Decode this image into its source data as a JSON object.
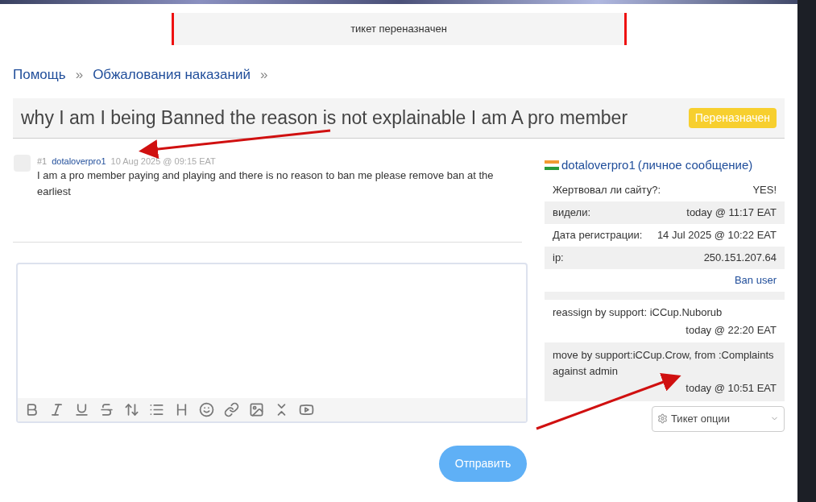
{
  "notice": "тикет переназначен",
  "breadcrumbs": [
    {
      "label": "Помощь",
      "separator": "»"
    },
    {
      "label": "Обжалования наказаний",
      "separator": "»"
    }
  ],
  "ticket": {
    "title": "why I am I being Banned the reason is not explainable I am A pro member",
    "status": "Переназначен"
  },
  "post": {
    "number": "#1",
    "author": "dotaloverpro1",
    "date": "10 Aug 2025 @ 09:15 EAT",
    "text": "I am a pro member paying and playing and there is no reason to ban me please remove ban at the earliest"
  },
  "sidebar": {
    "user": "dotaloverpro1",
    "pm_link": "(личное сообщение)",
    "info": [
      {
        "label": "Жертвовал ли сайту?:",
        "value": "YES!"
      },
      {
        "label": "видели:",
        "value": "today @ 11:17 EAT"
      },
      {
        "label": "Дата регистрации:",
        "value": "14 Jul 2025 @ 10:22 EAT"
      },
      {
        "label": "ip:",
        "value": "250.151.207.64"
      }
    ],
    "ban_link": "Ban user",
    "history": [
      {
        "text": "reassign by support: iCCup.Nuborub",
        "time": "today @ 22:20 EAT"
      },
      {
        "text": "move by support:iCCup.Crow, from :Complaints against admin",
        "time": "today @ 10:51 EAT"
      }
    ],
    "options_label": "Тикет опции"
  },
  "submit": "Отправить"
}
